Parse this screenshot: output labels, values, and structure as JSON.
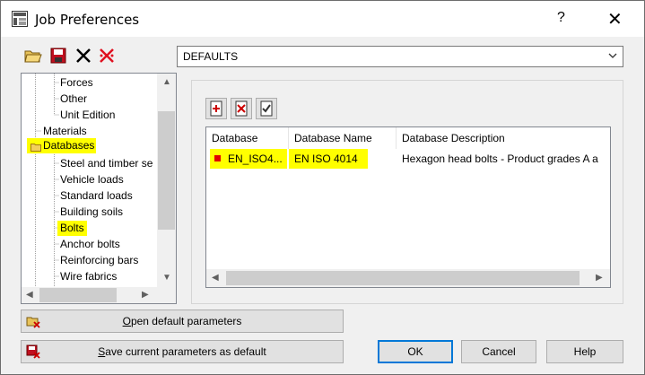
{
  "window": {
    "title": "Job Preferences",
    "help_glyph": "?",
    "close_glyph": "✕"
  },
  "toolbar": {
    "icons": [
      "open-folder-icon",
      "save-icon",
      "delete-icon",
      "delete-red-icon"
    ]
  },
  "preset": {
    "value": "DEFAULTS"
  },
  "tree": {
    "items": [
      {
        "label": "Forces"
      },
      {
        "label": "Other"
      },
      {
        "label": "Unit Edition"
      },
      {
        "label": "Materials"
      },
      {
        "label": "Databases",
        "highlighted": true
      },
      {
        "label": "Steel and timber se"
      },
      {
        "label": "Vehicle loads"
      },
      {
        "label": "Standard loads"
      },
      {
        "label": "Building soils"
      },
      {
        "label": "Bolts",
        "highlighted": true
      },
      {
        "label": "Anchor bolts"
      },
      {
        "label": "Reinforcing bars"
      },
      {
        "label": "Wire fabrics"
      }
    ]
  },
  "grid_toolbar": {
    "icons": [
      "add-database-icon",
      "remove-database-icon",
      "set-current-database-icon"
    ]
  },
  "table": {
    "columns": [
      "Database",
      "Database Name",
      "Database Description"
    ],
    "rows": [
      {
        "database": "EN_ISO4...",
        "name": "EN ISO 4014",
        "description": "Hexagon head bolts - Product grades A a"
      }
    ]
  },
  "buttons": {
    "open_default_underlined": "O",
    "open_default_rest": "pen default parameters",
    "save_current_underlined": "S",
    "save_current_rest": "ave current parameters as default",
    "ok": "OK",
    "cancel": "Cancel",
    "help": "Help"
  },
  "colors": {
    "highlight": "#ffff00",
    "accent": "#0078d7",
    "row_marker": "#e00000"
  }
}
